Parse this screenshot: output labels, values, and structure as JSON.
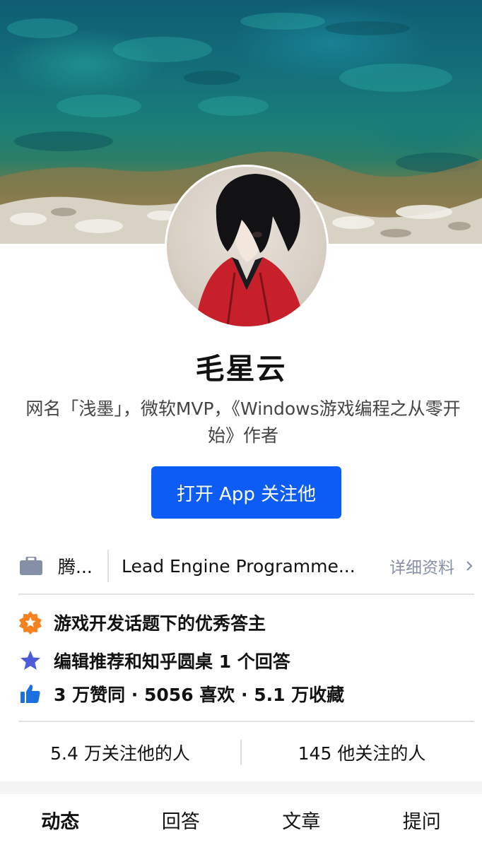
{
  "profile": {
    "name": "毛星云",
    "headline": "网名「浅墨」，微软MVP，《Windows游戏编程之从零开始》作者",
    "follow_button": "打开 App 关注他"
  },
  "info": {
    "company": "腾...",
    "job": "Lead Engine Programme...",
    "detail_link": "详细资料"
  },
  "achievements": [
    {
      "icon": "badge-icon",
      "text": "游戏开发话题下的优秀答主"
    },
    {
      "icon": "star-icon",
      "text": "编辑推荐和知乎圆桌 1 个回答"
    },
    {
      "icon": "thumbs-up-icon",
      "text": "3 万赞同 · 5056 喜欢 · 5.1 万收藏"
    }
  ],
  "stats": {
    "followers": "5.4 万关注他的人",
    "following": "145 他关注的人"
  },
  "tabs": [
    "动态",
    "回答",
    "文章",
    "提问"
  ],
  "colors": {
    "accent": "#0d5cf5",
    "badge": "#f5821f",
    "star": "#4e5bd8",
    "thumb": "#1b6fe0",
    "muted": "#8590a6"
  }
}
